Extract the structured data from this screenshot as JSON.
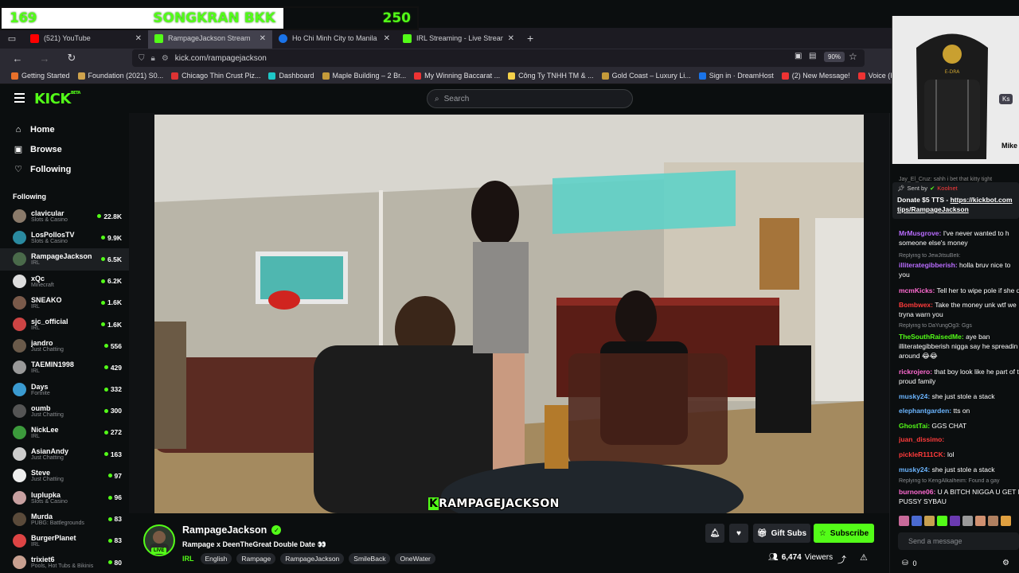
{
  "overlay": {
    "left_number": "169",
    "title": "SONGKRAN BKK",
    "right_number": "250"
  },
  "tabs": [
    {
      "label": "(521) YouTube",
      "color": "#ff0000",
      "active": false
    },
    {
      "label": "RampageJackson Stream",
      "color": "#53fc18",
      "active": true
    },
    {
      "label": "Ho Chi Minh City to Manila | G",
      "color": "#1a73e8",
      "active": false
    },
    {
      "label": "IRL Streaming - Live Streams or",
      "color": "#53fc18",
      "active": false
    }
  ],
  "address": {
    "url": "kick.com/rampagejackson",
    "zoom": "90%"
  },
  "bookmarks": [
    {
      "label": "Getting Started",
      "color": "#e8702a"
    },
    {
      "label": "Foundation (2021) S0...",
      "color": "#cfa34d"
    },
    {
      "label": "Chicago Thin Crust Piz...",
      "color": "#d33"
    },
    {
      "label": "Dashboard",
      "color": "#1ec8c8"
    },
    {
      "label": "Maple Building – 2 Br...",
      "color": "#c49a3a"
    },
    {
      "label": "My Winning Baccarat ...",
      "color": "#e33"
    },
    {
      "label": "Công Ty TNHH TM & ...",
      "color": "#f5d14a"
    },
    {
      "label": "Gold Coast – Luxury Li...",
      "color": "#c49a3a"
    },
    {
      "label": "Sign in · DreamHost",
      "color": "#1a73e8"
    },
    {
      "label": "(2) New Message!",
      "color": "#e33"
    },
    {
      "label": "Voice (Korean Drama) ...",
      "color": "#e33"
    },
    {
      "label": "(1) N",
      "color": "#f5d14a"
    }
  ],
  "header": {
    "logo": "KICK",
    "logo_sup": "BETA",
    "search_placeholder": "Search"
  },
  "nav": [
    {
      "label": "Home",
      "icon": "⌂"
    },
    {
      "label": "Browse",
      "icon": "▣"
    },
    {
      "label": "Following",
      "icon": "♡"
    }
  ],
  "following_title": "Following",
  "channels": [
    {
      "name": "clavicular",
      "category": "Slots & Casino",
      "viewers": "22.8K",
      "color": "#8a7a6a"
    },
    {
      "name": "LosPollosTV",
      "category": "Slots & Casino",
      "viewers": "9.9K",
      "color": "#2a8aa0"
    },
    {
      "name": "RampageJackson",
      "category": "IRL",
      "viewers": "6.5K",
      "color": "#4a6a4a"
    },
    {
      "name": "xQc",
      "category": "Minecraft",
      "viewers": "6.2K",
      "color": "#ddd"
    },
    {
      "name": "SNEAKO",
      "category": "IRL",
      "viewers": "1.6K",
      "color": "#7a5a4a"
    },
    {
      "name": "sjc_official",
      "category": "IRL",
      "viewers": "1.6K",
      "color": "#c44"
    },
    {
      "name": "jandro",
      "category": "Just Chatting",
      "viewers": "556",
      "color": "#6a5a4a"
    },
    {
      "name": "TAEMIN1998",
      "category": "IRL",
      "viewers": "429",
      "color": "#999"
    },
    {
      "name": "Days",
      "category": "Fortnite",
      "viewers": "332",
      "color": "#3a9ad0"
    },
    {
      "name": "oumb",
      "category": "Just Chatting",
      "viewers": "300",
      "color": "#555"
    },
    {
      "name": "NickLee",
      "category": "IRL",
      "viewers": "272",
      "color": "#3c9a3c"
    },
    {
      "name": "AsianAndy",
      "category": "Just Chatting",
      "viewers": "163",
      "color": "#ccc"
    },
    {
      "name": "Steve",
      "category": "Just Chatting",
      "viewers": "97",
      "color": "#eee"
    },
    {
      "name": "luplupka",
      "category": "Slots & Casino",
      "viewers": "96",
      "color": "#c8a0a0"
    },
    {
      "name": "Murda",
      "category": "PUBG: Battlegrounds",
      "viewers": "83",
      "color": "#5a4a3a"
    },
    {
      "name": "BurgerPlanet",
      "category": "IRL",
      "viewers": "83",
      "color": "#d44"
    },
    {
      "name": "trixiet6",
      "category": "Pools, Hot Tubs & Bikinis",
      "viewers": "80",
      "color": "#c8a090"
    }
  ],
  "video": {
    "watermark_k": "K",
    "watermark": "RAMPAGEJACKSON"
  },
  "stream": {
    "name": "RampageJackson",
    "title": "Rampage x DeenTheGreat Double Date 👀",
    "category": "IRL",
    "tags": [
      "English",
      "Rampage",
      "RampageJackson",
      "SmileBack",
      "OneWater"
    ],
    "live": "LIVE",
    "gift_label": "Gift Subs",
    "subscribe_label": "Subscribe",
    "viewers": "6,474",
    "viewers_label": "Viewers"
  },
  "webcam": {
    "ks": "Ks",
    "name": "Mike"
  },
  "chat": {
    "top_partial": "Jay_El_Cruz: sahh i bet that kitty tight",
    "pinned_sent_by": "Sent by",
    "pinned_user": "Koolnet",
    "pinned_text1": "Donate $5 TTS - ",
    "pinned_link1": "https://kickbot.com",
    "pinned_link2": "tips/RampageJackson",
    "messages": [
      {
        "user": "MrMusgrove:",
        "color": "#b96cff",
        "text": " I've never wanted to h"
      },
      {
        "user": "",
        "color": "#fff",
        "text": "someone else's money"
      },
      {
        "user": "illiterategibberish:",
        "color": "#b96cff",
        "text": " holla bruv nice to"
      },
      {
        "user": "",
        "color": "#fff",
        "text": "you"
      },
      {
        "user": "mcmKicks:",
        "color": "#ff6bd1",
        "text": " Tell her to wipe pole if she d"
      },
      {
        "user": "Bombwex:",
        "color": "#ff3b3b",
        "text": " Take the money unk wtf we"
      },
      {
        "user": "",
        "color": "#fff",
        "text": "tryna warn you"
      },
      {
        "user": "TheSouthRaisedMe:",
        "color": "#53fc18",
        "text": " aye ban"
      },
      {
        "user": "",
        "color": "#fff",
        "text": "illiterategibberish nigga say he spreadin"
      },
      {
        "user": "",
        "color": "#fff",
        "text": "around 😂😂"
      },
      {
        "user": "rickrojero:",
        "color": "#ff6bd1",
        "text": " that boy look like he part of t"
      },
      {
        "user": "",
        "color": "#fff",
        "text": "proud family"
      },
      {
        "user": "musky24:",
        "color": "#6bb5ff",
        "text": " she just stole a stack"
      },
      {
        "user": "elephantgarden:",
        "color": "#6bb5ff",
        "text": " tts on"
      },
      {
        "user": "GhostTai:",
        "color": "#53fc18",
        "text": " GGS CHAT"
      },
      {
        "user": "juan_dissimo:",
        "color": "#ff3b3b",
        "text": ""
      },
      {
        "user": "pickleR111CK:",
        "color": "#ff3b3b",
        "text": " lol"
      },
      {
        "user": "musky24:",
        "color": "#6bb5ff",
        "text": " she just stole a stack"
      },
      {
        "user": "burnone06:",
        "color": "#ff6bd1",
        "text": " U A BITCH NIGGA U GET N"
      },
      {
        "user": "",
        "color": "#fff",
        "text": "PUSSY SYBAU"
      }
    ],
    "replies": [
      "Replying to JewJitsuBeli:",
      "Replying to DaYungOg3: Ggs",
      "Replying to KengAlkalheim: Found a gay"
    ],
    "send_placeholder": "Send a message",
    "points": "0"
  }
}
